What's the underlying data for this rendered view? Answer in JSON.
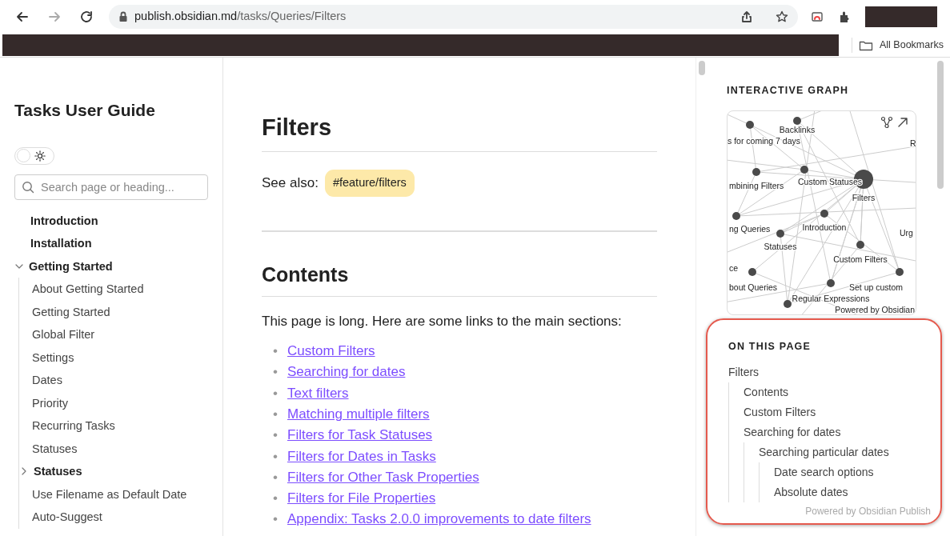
{
  "browser": {
    "url_host": "publish.obsidian.md",
    "url_path": "/tasks/Queries/Filters",
    "forward_disabled": true,
    "bookmarks_label": "All Bookmarks"
  },
  "sidebar": {
    "title": "Tasks User Guide",
    "theme_toggle": {
      "on": false
    },
    "search": {
      "placeholder": "Search page or heading..."
    },
    "items": [
      {
        "label": "Introduction"
      },
      {
        "label": "Installation"
      },
      {
        "label": "Getting Started",
        "expanded": true,
        "children": [
          {
            "label": "About Getting Started"
          },
          {
            "label": "Getting Started"
          },
          {
            "label": "Global Filter"
          },
          {
            "label": "Settings"
          },
          {
            "label": "Dates"
          },
          {
            "label": "Priority"
          },
          {
            "label": "Recurring Tasks"
          },
          {
            "label": "Statuses"
          },
          {
            "label": "Statuses",
            "expanded": false
          },
          {
            "label": "Use Filename as Default Date"
          },
          {
            "label": "Auto-Suggest"
          }
        ]
      }
    ]
  },
  "article": {
    "title": "Filters",
    "see_also_label": "See also:",
    "tag": "#feature/filters",
    "contents_heading": "Contents",
    "intro": "This page is long. Here are some links to the main sections:",
    "bullet": "•",
    "links": [
      "Custom Filters",
      "Searching for dates",
      "Text filters",
      "Matching multiple filters",
      "Filters for Task Statuses",
      "Filters for Dates in Tasks",
      "Filters for Other Task Properties",
      "Filters for File Properties",
      "Appendix: Tasks 2.0.0 improvements to date filters"
    ]
  },
  "graph": {
    "heading": "INTERACTIVE GRAPH",
    "labels": [
      "Backlinks",
      "s for coming 7 days",
      "R",
      "mbining Filters",
      "Custom Statuses",
      "Filters",
      "ng Queries",
      "Introduction",
      "Urg",
      "Statuses",
      "Custom Filters",
      "ce",
      "bout Queries",
      "Set up custom",
      "Regular Expressions",
      "Powered by Obsidian"
    ]
  },
  "toc": {
    "heading": "ON THIS PAGE",
    "items": [
      {
        "label": "Filters",
        "children": [
          {
            "label": "Contents"
          },
          {
            "label": "Custom Filters"
          },
          {
            "label": "Searching for dates",
            "children": [
              {
                "label": "Searching particular dates",
                "children": [
                  {
                    "label": "Date search options"
                  },
                  {
                    "label": "Absolute dates"
                  }
                ]
              }
            ]
          }
        ]
      }
    ],
    "footer": "Powered by Obsidian Publish"
  }
}
